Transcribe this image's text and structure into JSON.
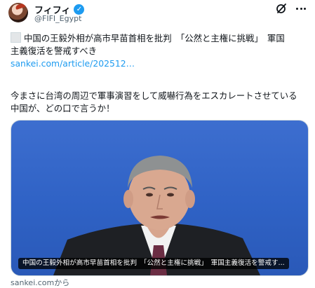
{
  "author": {
    "display_name": "フィフィ",
    "handle": "@FIFI_Egypt",
    "verified_mark": "✓"
  },
  "icons": {
    "avatar": "avatar",
    "verified": "verified-badge-icon",
    "grok": "grok-icon",
    "more": "more-options-icon",
    "article": "article-square-icon"
  },
  "tweet": {
    "line1": "中国の王毅外相が高市早苗首相を批判　「公然と主権に挑戦」　軍国",
    "line2": "主義復活を警戒すべき",
    "link": "sankei.com/article/202512…",
    "line3": "今まさに台湾の周辺で軍事演習をして威嚇行為をエスカレートさせている",
    "line4": "中国が、どの口で言うか！"
  },
  "card": {
    "caption": "中国の王毅外相が高市早苗首相を批判　「公然と主権に挑戦」　軍国主義復活を警戒す...",
    "source": "sankei.comから"
  },
  "colors": {
    "accent": "#1d9bf0",
    "background": "#ffffff",
    "text": "#0f1419",
    "muted": "#536471",
    "photo_background": "#3466c9"
  }
}
